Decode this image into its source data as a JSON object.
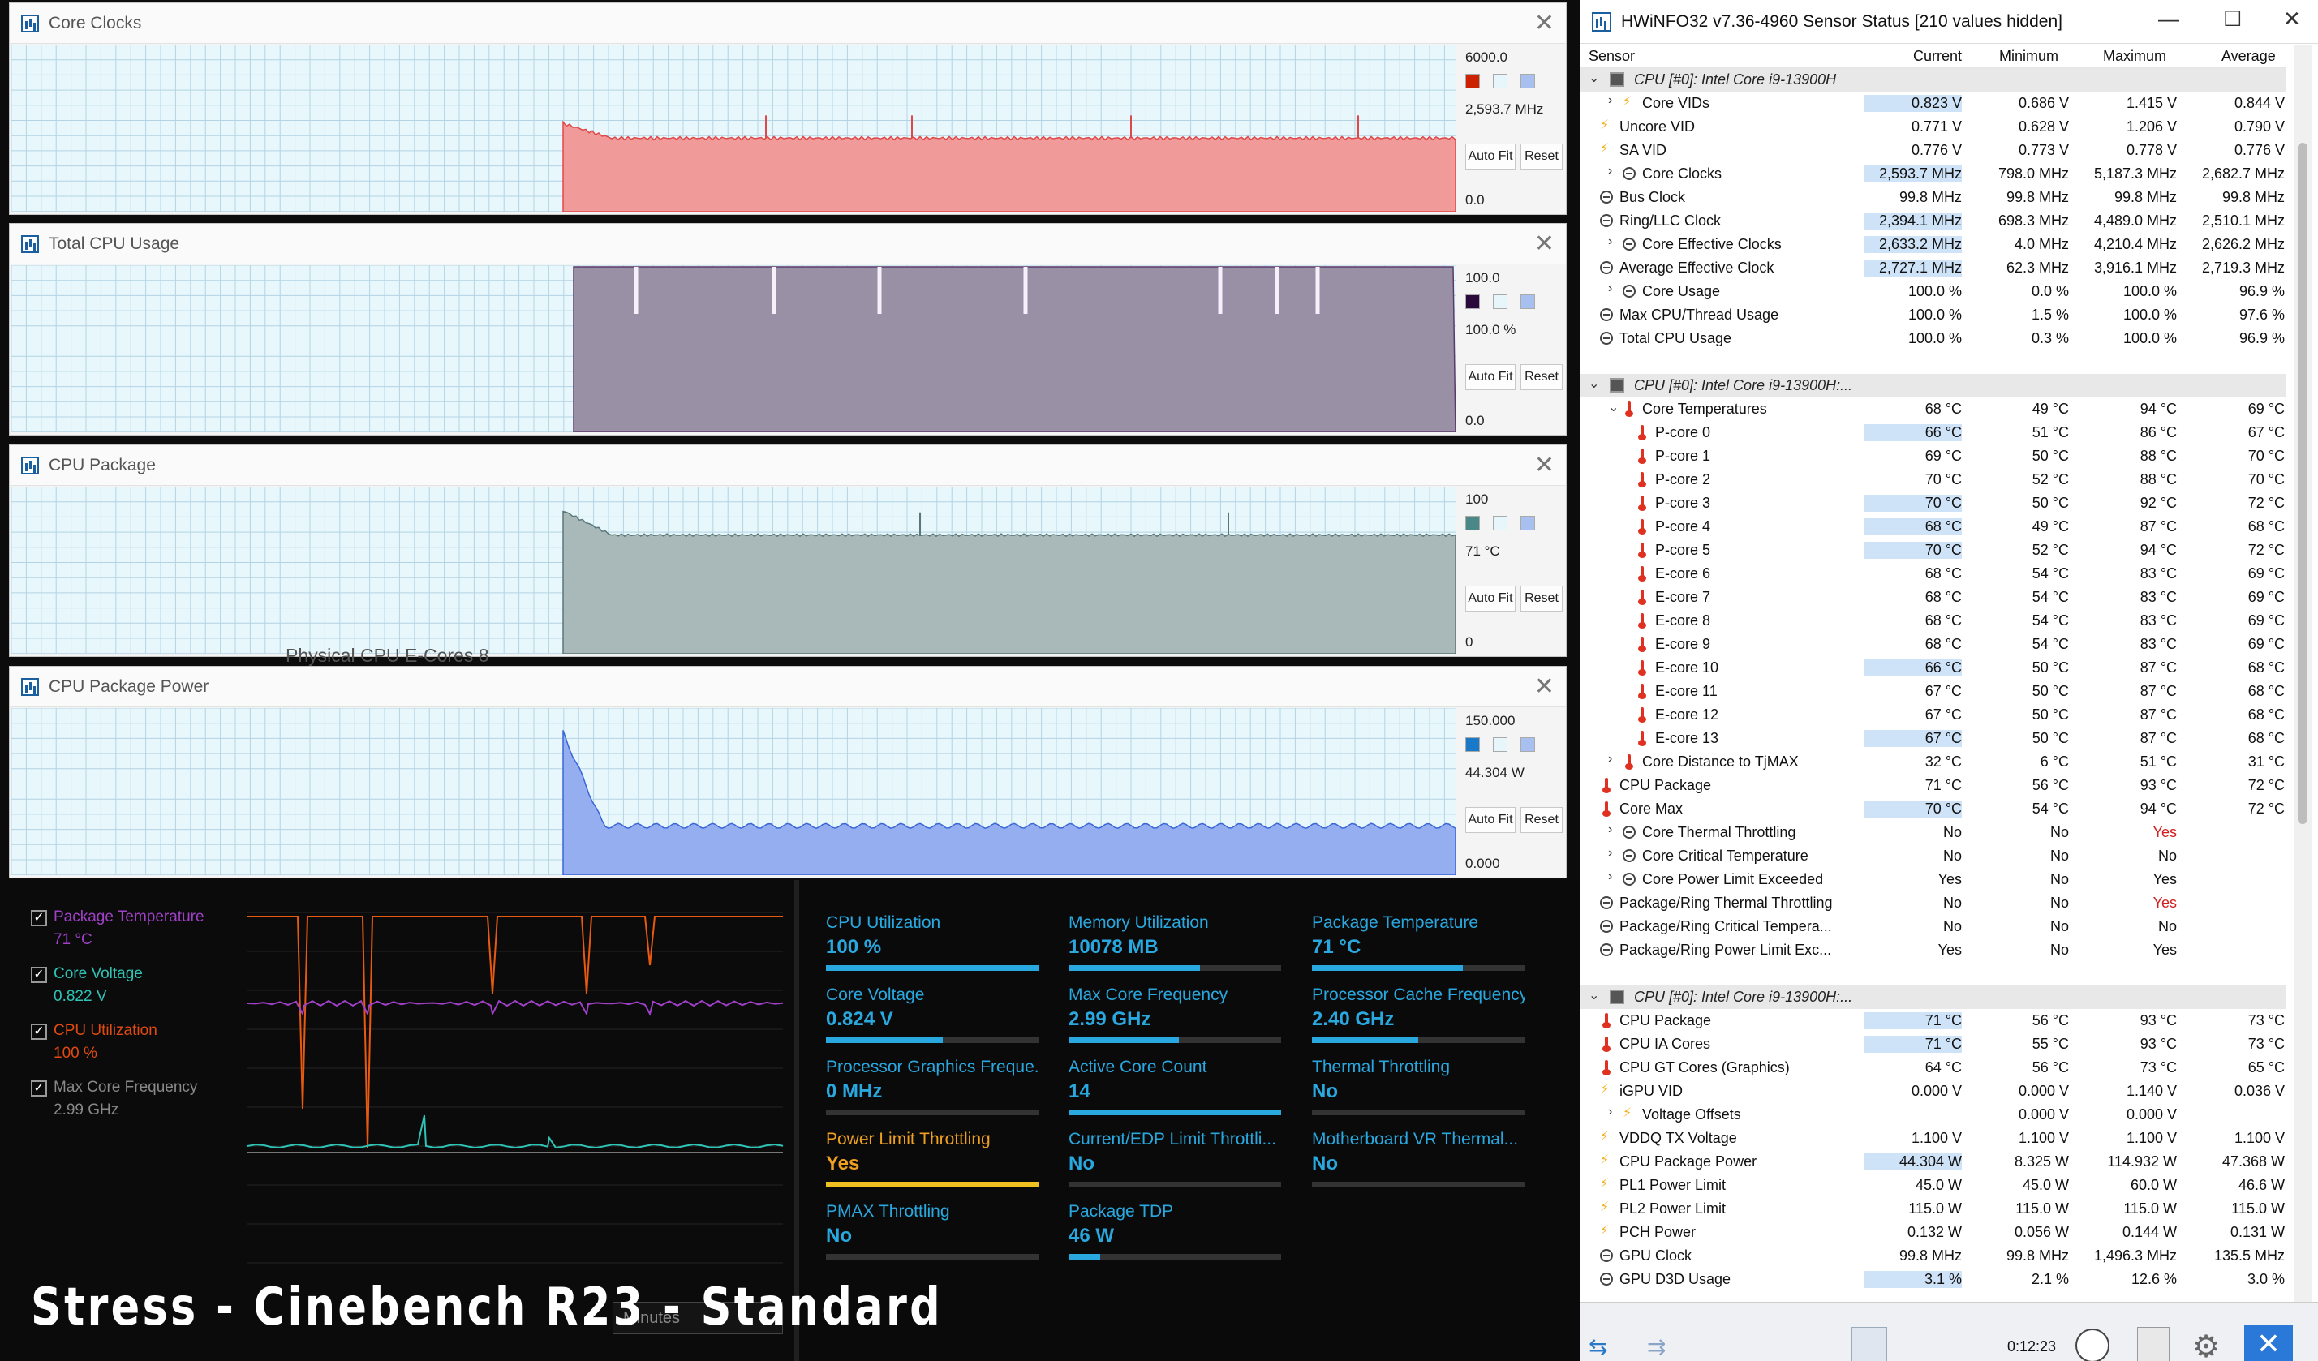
{
  "graphs": [
    {
      "title": "Core Clocks",
      "max": "6000.0",
      "current": "2,593.7 MHz",
      "min": "0.0",
      "color": "#f09a9a",
      "line": "#e04848",
      "sw": "#cc2200",
      "level": 0.44
    },
    {
      "title": "Total CPU Usage",
      "max": "100.0",
      "current": "100.0 %",
      "min": "0.0",
      "color": "#9a90a6",
      "line": "#5a3a6a",
      "sw": "#2a0a3a",
      "level": 1.0
    },
    {
      "title": "CPU Package",
      "max": "100",
      "current": "71 °C",
      "min": "0",
      "color": "#a9b8b8",
      "line": "#5a7878",
      "sw": "#4a8888",
      "level": 0.71
    },
    {
      "title": "CPU Package Power",
      "max": "150.000",
      "current": "44.304 W",
      "min": "0.000",
      "color": "#94aef0",
      "line": "#3a66d8",
      "sw": "#1a78c8",
      "level": 0.295
    }
  ],
  "buttons": {
    "auto_fit": "Auto Fit",
    "reset": "Reset"
  },
  "hwinfo": {
    "title": "HWiNFO32 v7.36-4960 Sensor Status [210 values hidden]",
    "columns": [
      "Sensor",
      "Current",
      "Minimum",
      "Maximum",
      "Average"
    ],
    "elapsed": "0:12:23",
    "rows": [
      {
        "g": 1,
        "label": "CPU [#0]: Intel Core i9-13900H"
      },
      {
        "i": 1,
        "e": 1,
        "ic": "volt",
        "label": "Core VIDs",
        "c": "0.823 V",
        "mn": "0.686 V",
        "mx": "1.415 V",
        "av": "0.844 V",
        "h": 1
      },
      {
        "i": 0,
        "ic": "volt",
        "label": "Uncore VID",
        "c": "0.771 V",
        "mn": "0.628 V",
        "mx": "1.206 V",
        "av": "0.790 V"
      },
      {
        "i": 0,
        "ic": "volt",
        "label": "SA VID",
        "c": "0.776 V",
        "mn": "0.773 V",
        "mx": "0.778 V",
        "av": "0.776 V"
      },
      {
        "i": 1,
        "e": 1,
        "ic": "clock",
        "label": "Core Clocks",
        "c": "2,593.7 MHz",
        "mn": "798.0 MHz",
        "mx": "5,187.3 MHz",
        "av": "2,682.7 MHz",
        "h": 1
      },
      {
        "i": 0,
        "ic": "clock",
        "label": "Bus Clock",
        "c": "99.8 MHz",
        "mn": "99.8 MHz",
        "mx": "99.8 MHz",
        "av": "99.8 MHz"
      },
      {
        "i": 0,
        "ic": "clock",
        "label": "Ring/LLC Clock",
        "c": "2,394.1 MHz",
        "mn": "698.3 MHz",
        "mx": "4,489.0 MHz",
        "av": "2,510.1 MHz",
        "h": 1
      },
      {
        "i": 1,
        "e": 1,
        "ic": "clock",
        "label": "Core Effective Clocks",
        "c": "2,633.2 MHz",
        "mn": "4.0 MHz",
        "mx": "4,210.4 MHz",
        "av": "2,626.2 MHz",
        "h": 1
      },
      {
        "i": 0,
        "ic": "clock",
        "label": "Average Effective Clock",
        "c": "2,727.1 MHz",
        "mn": "62.3 MHz",
        "mx": "3,916.1 MHz",
        "av": "2,719.3 MHz",
        "h": 1
      },
      {
        "i": 1,
        "e": 1,
        "ic": "clock",
        "label": "Core Usage",
        "c": "100.0 %",
        "mn": "0.0 %",
        "mx": "100.0 %",
        "av": "96.9 %"
      },
      {
        "i": 0,
        "ic": "clock",
        "label": "Max CPU/Thread Usage",
        "c": "100.0 %",
        "mn": "1.5 %",
        "mx": "100.0 %",
        "av": "97.6 %"
      },
      {
        "i": 0,
        "ic": "clock",
        "label": "Total CPU Usage",
        "c": "100.0 %",
        "mn": "0.3 %",
        "mx": "100.0 %",
        "av": "96.9 %"
      },
      {
        "blank": 1
      },
      {
        "g": 1,
        "label": "CPU [#0]: Intel Core i9-13900H:..."
      },
      {
        "i": 1,
        "e": 2,
        "ic": "temp",
        "label": "Core Temperatures",
        "c": "68 °C",
        "mn": "49 °C",
        "mx": "94 °C",
        "av": "69 °C"
      },
      {
        "i": 2,
        "ic": "temp",
        "label": "P-core 0",
        "c": "66 °C",
        "mn": "51 °C",
        "mx": "86 °C",
        "av": "67 °C",
        "h": 1
      },
      {
        "i": 2,
        "ic": "temp",
        "label": "P-core 1",
        "c": "69 °C",
        "mn": "50 °C",
        "mx": "88 °C",
        "av": "70 °C"
      },
      {
        "i": 2,
        "ic": "temp",
        "label": "P-core 2",
        "c": "70 °C",
        "mn": "52 °C",
        "mx": "88 °C",
        "av": "70 °C"
      },
      {
        "i": 2,
        "ic": "temp",
        "label": "P-core 3",
        "c": "70 °C",
        "mn": "50 °C",
        "mx": "92 °C",
        "av": "72 °C",
        "h": 1
      },
      {
        "i": 2,
        "ic": "temp",
        "label": "P-core 4",
        "c": "68 °C",
        "mn": "49 °C",
        "mx": "87 °C",
        "av": "68 °C",
        "h": 1
      },
      {
        "i": 2,
        "ic": "temp",
        "label": "P-core 5",
        "c": "70 °C",
        "mn": "52 °C",
        "mx": "94 °C",
        "av": "72 °C",
        "h": 1
      },
      {
        "i": 2,
        "ic": "temp",
        "label": "E-core 6",
        "c": "68 °C",
        "mn": "54 °C",
        "mx": "83 °C",
        "av": "69 °C"
      },
      {
        "i": 2,
        "ic": "temp",
        "label": "E-core 7",
        "c": "68 °C",
        "mn": "54 °C",
        "mx": "83 °C",
        "av": "69 °C"
      },
      {
        "i": 2,
        "ic": "temp",
        "label": "E-core 8",
        "c": "68 °C",
        "mn": "54 °C",
        "mx": "83 °C",
        "av": "69 °C"
      },
      {
        "i": 2,
        "ic": "temp",
        "label": "E-core 9",
        "c": "68 °C",
        "mn": "54 °C",
        "mx": "83 °C",
        "av": "69 °C"
      },
      {
        "i": 2,
        "ic": "temp",
        "label": "E-core 10",
        "c": "66 °C",
        "mn": "50 °C",
        "mx": "87 °C",
        "av": "68 °C",
        "h": 1
      },
      {
        "i": 2,
        "ic": "temp",
        "label": "E-core 11",
        "c": "67 °C",
        "mn": "50 °C",
        "mx": "87 °C",
        "av": "68 °C"
      },
      {
        "i": 2,
        "ic": "temp",
        "label": "E-core 12",
        "c": "67 °C",
        "mn": "50 °C",
        "mx": "87 °C",
        "av": "68 °C"
      },
      {
        "i": 2,
        "ic": "temp",
        "label": "E-core 13",
        "c": "67 °C",
        "mn": "50 °C",
        "mx": "87 °C",
        "av": "68 °C",
        "h": 1
      },
      {
        "i": 1,
        "e": 1,
        "ic": "temp",
        "label": "Core Distance to TjMAX",
        "c": "32 °C",
        "mn": "6 °C",
        "mx": "51 °C",
        "av": "31 °C"
      },
      {
        "i": 0,
        "ic": "temp",
        "label": "CPU Package",
        "c": "71 °C",
        "mn": "56 °C",
        "mx": "93 °C",
        "av": "72 °C"
      },
      {
        "i": 0,
        "ic": "temp",
        "label": "Core Max",
        "c": "70 °C",
        "mn": "54 °C",
        "mx": "94 °C",
        "av": "72 °C",
        "h": 1
      },
      {
        "i": 1,
        "e": 1,
        "ic": "clock",
        "label": "Core Thermal Throttling",
        "c": "No",
        "mn": "No",
        "mx": "Yes",
        "av": "",
        "r": 1
      },
      {
        "i": 1,
        "e": 1,
        "ic": "clock",
        "label": "Core Critical Temperature",
        "c": "No",
        "mn": "No",
        "mx": "No",
        "av": ""
      },
      {
        "i": 1,
        "e": 1,
        "ic": "clock",
        "label": "Core Power Limit Exceeded",
        "c": "Yes",
        "mn": "No",
        "mx": "Yes",
        "av": ""
      },
      {
        "i": 0,
        "ic": "clock",
        "label": "Package/Ring Thermal Throttling",
        "c": "No",
        "mn": "No",
        "mx": "Yes",
        "av": "",
        "r": 1
      },
      {
        "i": 0,
        "ic": "clock",
        "label": "Package/Ring Critical Tempera...",
        "c": "No",
        "mn": "No",
        "mx": "No",
        "av": ""
      },
      {
        "i": 0,
        "ic": "clock",
        "label": "Package/Ring Power Limit Exc...",
        "c": "Yes",
        "mn": "No",
        "mx": "Yes",
        "av": ""
      },
      {
        "blank": 1
      },
      {
        "g": 1,
        "label": "CPU [#0]: Intel Core i9-13900H:..."
      },
      {
        "i": 0,
        "ic": "temp",
        "label": "CPU Package",
        "c": "71 °C",
        "mn": "56 °C",
        "mx": "93 °C",
        "av": "73 °C",
        "h": 1
      },
      {
        "i": 0,
        "ic": "temp",
        "label": "CPU IA Cores",
        "c": "71 °C",
        "mn": "55 °C",
        "mx": "93 °C",
        "av": "73 °C",
        "h": 1
      },
      {
        "i": 0,
        "ic": "temp",
        "label": "CPU GT Cores (Graphics)",
        "c": "64 °C",
        "mn": "56 °C",
        "mx": "73 °C",
        "av": "65 °C"
      },
      {
        "i": 0,
        "ic": "volt",
        "label": "iGPU VID",
        "c": "0.000 V",
        "mn": "0.000 V",
        "mx": "1.140 V",
        "av": "0.036 V"
      },
      {
        "i": 1,
        "e": 1,
        "ic": "volt",
        "label": "Voltage Offsets",
        "c": "",
        "mn": "0.000 V",
        "mx": "0.000 V",
        "av": ""
      },
      {
        "i": 0,
        "ic": "volt",
        "label": "VDDQ TX Voltage",
        "c": "1.100 V",
        "mn": "1.100 V",
        "mx": "1.100 V",
        "av": "1.100 V"
      },
      {
        "i": 0,
        "ic": "volt",
        "label": "CPU Package Power",
        "c": "44.304 W",
        "mn": "8.325 W",
        "mx": "114.932 W",
        "av": "47.368 W",
        "h": 1
      },
      {
        "i": 0,
        "ic": "volt",
        "label": "PL1 Power Limit",
        "c": "45.0 W",
        "mn": "45.0 W",
        "mx": "60.0 W",
        "av": "46.6 W"
      },
      {
        "i": 0,
        "ic": "volt",
        "label": "PL2 Power Limit",
        "c": "115.0 W",
        "mn": "115.0 W",
        "mx": "115.0 W",
        "av": "115.0 W"
      },
      {
        "i": 0,
        "ic": "volt",
        "label": "PCH Power",
        "c": "0.132 W",
        "mn": "0.056 W",
        "mx": "0.144 W",
        "av": "0.131 W"
      },
      {
        "i": 0,
        "ic": "clock",
        "label": "GPU Clock",
        "c": "99.8 MHz",
        "mn": "99.8 MHz",
        "mx": "1,496.3 MHz",
        "av": "135.5 MHz"
      },
      {
        "i": 0,
        "ic": "clock",
        "label": "GPU D3D Usage",
        "c": "3.1 %",
        "mn": "2.1 %",
        "mx": "12.6 %",
        "av": "3.0 %",
        "h": 1
      }
    ]
  },
  "legend": [
    {
      "name": "Package Temperature",
      "value": "71 °C",
      "color": "#a040c8"
    },
    {
      "name": "Core Voltage",
      "value": "0.822 V",
      "color": "#2ec4b6"
    },
    {
      "name": "CPU Utilization",
      "value": "100 %",
      "color": "#e04a10"
    },
    {
      "name": "Max Core Frequency",
      "value": "2.99 GHz",
      "color": "#888888"
    }
  ],
  "tiles": [
    {
      "name": "CPU Utilization",
      "value": "100 %",
      "level": 1.0
    },
    {
      "name": "Memory Utilization",
      "value": "10078  MB",
      "level": 0.62
    },
    {
      "name": "Package Temperature",
      "value": "71 °C",
      "level": 0.71
    },
    {
      "name": "Core Voltage",
      "value": "0.824 V",
      "level": 0.55
    },
    {
      "name": "Max Core Frequency",
      "value": "2.99 GHz",
      "level": 0.52
    },
    {
      "name": "Processor Cache Frequency",
      "value": "2.40 GHz",
      "level": 0.5
    },
    {
      "name": "Processor Graphics Freque...",
      "value": "0 MHz",
      "level": 0.0
    },
    {
      "name": "Active Core Count",
      "value": "14",
      "level": 1.0
    },
    {
      "name": "Thermal Throttling",
      "value": "No",
      "level": 0.0
    },
    {
      "name": "Power Limit Throttling",
      "value": "Yes",
      "level": 1.0,
      "warn": 1
    },
    {
      "name": "Current/EDP Limit Throttli...",
      "value": "No",
      "level": 0.0
    },
    {
      "name": "Motherboard VR Thermal...",
      "value": "No",
      "level": 0.0
    },
    {
      "name": "PMAX Throttling",
      "value": "No",
      "level": 0.0
    },
    {
      "name": "Package TDP",
      "value": "46 W",
      "level": 0.15
    }
  ],
  "dropdown": {
    "value": "Minutes"
  },
  "caption": "Stress - Cinebench R23 - Standard",
  "ghost_text": "Physical CPU E-Cores  8"
}
